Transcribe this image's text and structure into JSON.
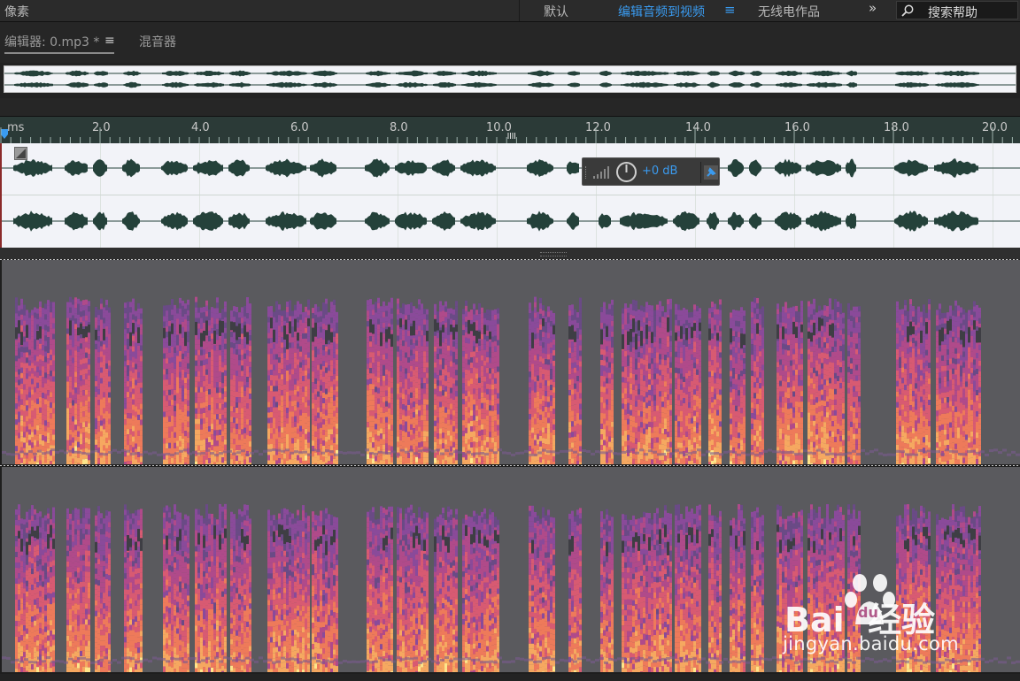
{
  "workspace_bar": {
    "left_label": "像素",
    "workspace_default": "默认",
    "workspace_active": "编辑音频到视频",
    "workspace_radio": "无线电作品",
    "active_color": "#3a9bf0",
    "search_placeholder": "搜索帮助"
  },
  "tabs": {
    "editor_label": "编辑器: 0.mp3 *",
    "mixer_label": "混音器"
  },
  "ruler": {
    "unit_label": "ms",
    "tick_labels": [
      "2.0",
      "4.0",
      "6.0",
      "8.0",
      "10.0",
      "12.0",
      "14.0",
      "16.0",
      "18.0",
      "20.0"
    ]
  },
  "hud": {
    "gain_value": "+0 dB",
    "gain_color": "#3a9bf0"
  },
  "watermark": {
    "brand_text": "Bai  经验",
    "paw_text": "du",
    "url": "jingyan.baidu.com"
  },
  "colors": {
    "waveform": "#24413a",
    "ruler_bg": "#2b3a37",
    "spectral_bg": "#5a5a5e"
  },
  "icons": {
    "search": "search-icon",
    "menu": "hamburger-menu-icon",
    "more": "double-chevron-right-icon",
    "power": "power-icon",
    "pin": "pin-icon",
    "level": "level-meter-icon",
    "playhead": "playhead-marker-icon"
  }
}
